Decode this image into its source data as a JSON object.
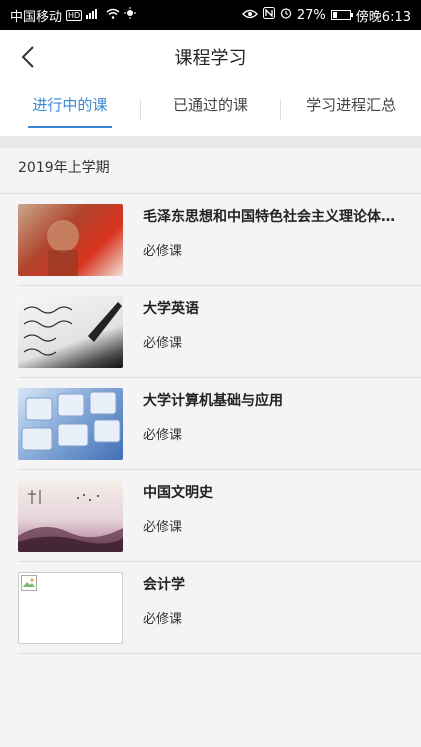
{
  "status": {
    "carrier": "中国移动",
    "hd": "HD",
    "network": "4G",
    "battery_percent": "27%",
    "battery_level": 0.27,
    "time": "傍晚6:13"
  },
  "header": {
    "title": "课程学习"
  },
  "tabs": [
    {
      "label": "进行中的课",
      "active": true
    },
    {
      "label": "已通过的课",
      "active": false
    },
    {
      "label": "学习进程汇总",
      "active": false
    }
  ],
  "semester": "2019年上学期",
  "courses": [
    {
      "name": "毛泽东思想和中国特色社会主义理论体系...",
      "type": "必修课",
      "thumb": "red-portrait"
    },
    {
      "name": "大学英语",
      "type": "必修课",
      "thumb": "pen-writing"
    },
    {
      "name": "大学计算机基础与应用",
      "type": "必修课",
      "thumb": "keyboard"
    },
    {
      "name": "中国文明史",
      "type": "必修课",
      "thumb": "ink-painting"
    },
    {
      "name": "会计学",
      "type": "必修课",
      "thumb": "broken-image"
    }
  ],
  "colors": {
    "accent": "#3a87d6",
    "statusbar": "#000000",
    "background": "#f4f4f6"
  }
}
